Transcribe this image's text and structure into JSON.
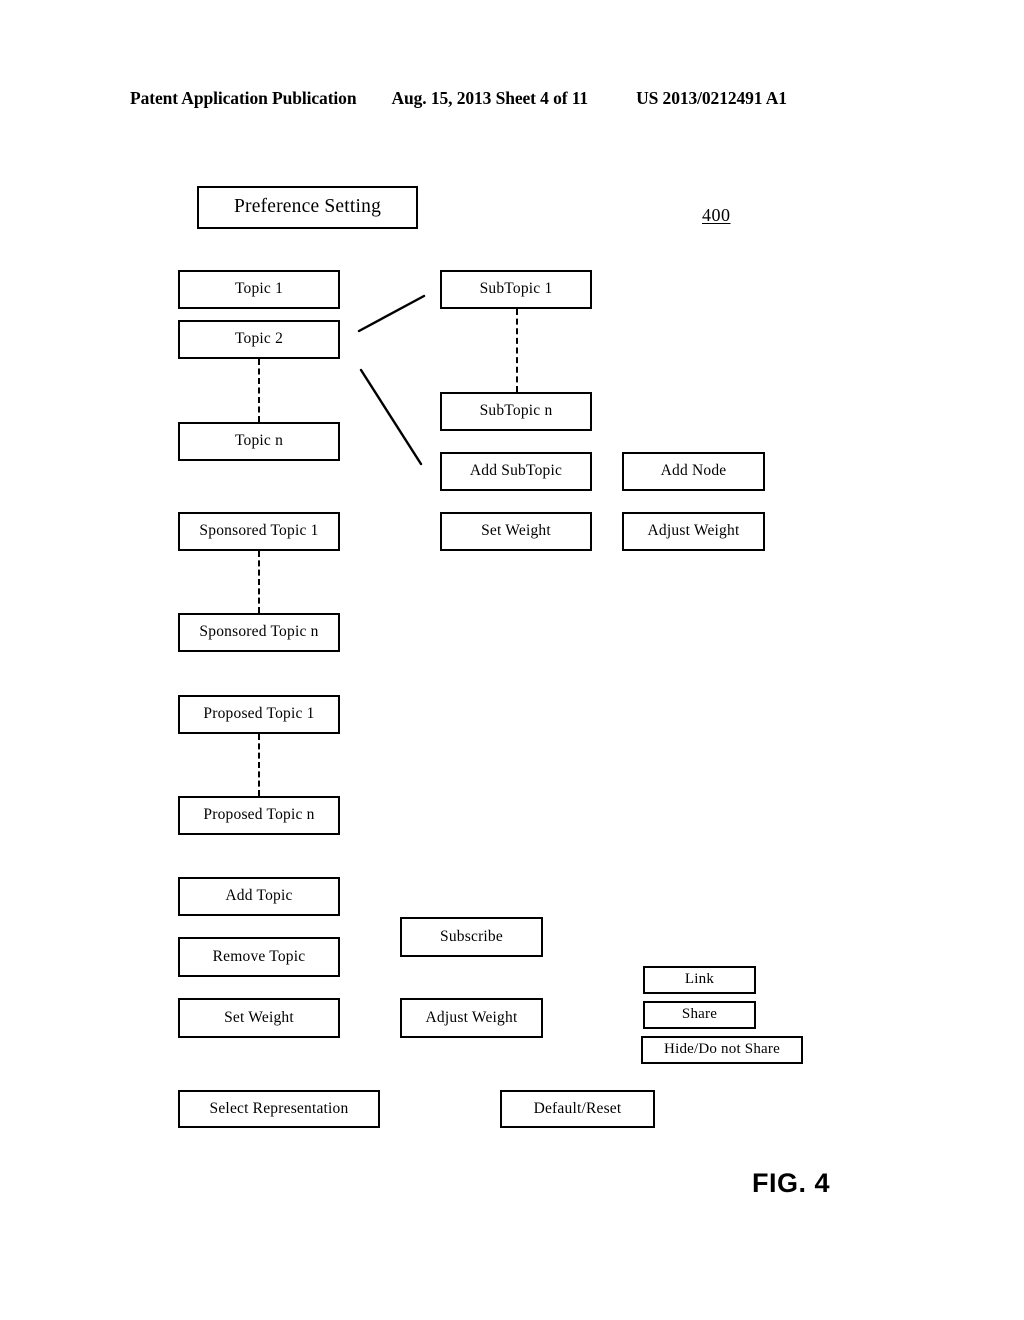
{
  "header": {
    "publication": "Patent Application Publication",
    "date_sheet": "Aug. 15, 2013  Sheet 4 of 11",
    "patent_number": "US 2013/0212491 A1"
  },
  "figure": {
    "label": "FIG. 4",
    "reference_numeral": "400"
  },
  "diagram": {
    "title_box": {
      "label": "Preference Setting"
    },
    "topics": [
      {
        "label": "Topic 1"
      },
      {
        "label": "Topic 2"
      },
      {
        "label": "Topic n"
      }
    ],
    "sponsored_topics": [
      {
        "label": "Sponsored Topic 1"
      },
      {
        "label": "Sponsored Topic n"
      }
    ],
    "proposed_topics": [
      {
        "label": "Proposed Topic 1"
      },
      {
        "label": "Proposed Topic n"
      }
    ],
    "subtopics": [
      {
        "label": "SubTopic 1"
      },
      {
        "label": "SubTopic n"
      }
    ],
    "subtopic_actions": [
      {
        "label": "Add SubTopic"
      },
      {
        "label": "Set Weight"
      }
    ],
    "node_actions": [
      {
        "label": "Add Node"
      },
      {
        "label": "Adjust Weight"
      }
    ],
    "topic_actions": [
      {
        "label": "Add Topic"
      },
      {
        "label": "Remove Topic"
      },
      {
        "label": "Set Weight"
      }
    ],
    "subscription_actions": [
      {
        "label": "Subscribe"
      },
      {
        "label": "Adjust Weight"
      }
    ],
    "sharing_actions": [
      {
        "label": "Link"
      },
      {
        "label": "Share"
      },
      {
        "label": "Hide/Do not Share"
      }
    ],
    "global_actions": [
      {
        "label": "Select Representation"
      },
      {
        "label": "Default/Reset"
      }
    ]
  },
  "colors": {
    "ink": "#000000",
    "paper": "#ffffff"
  }
}
